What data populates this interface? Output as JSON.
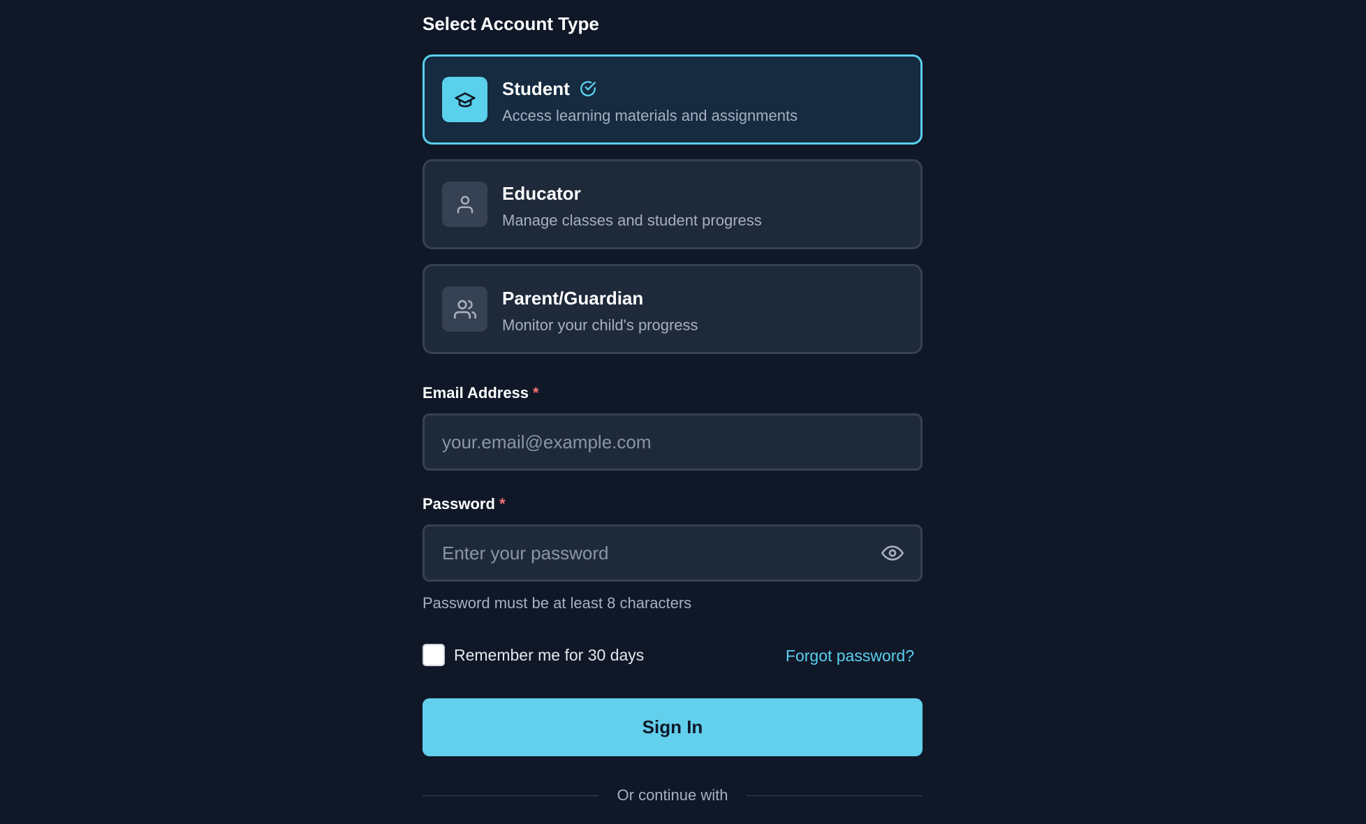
{
  "account_section": {
    "title": "Select Account Type",
    "options": [
      {
        "icon": "graduation-cap-icon",
        "title": "Student",
        "description": "Access learning materials and assignments",
        "selected": true
      },
      {
        "icon": "user-icon",
        "title": "Educator",
        "description": "Manage classes and student progress",
        "selected": false
      },
      {
        "icon": "users-icon",
        "title": "Parent/Guardian",
        "description": "Monitor your child's progress",
        "selected": false
      }
    ]
  },
  "email": {
    "label": "Email Address",
    "required_mark": "*",
    "value": "",
    "placeholder": "your.email@example.com"
  },
  "password": {
    "label": "Password",
    "required_mark": "*",
    "value": "",
    "placeholder": "Enter your password",
    "toggle_icon": "eye-icon",
    "hint": "Password must be at least 8 characters"
  },
  "remember": {
    "label": "Remember me for 30 days",
    "checked": false
  },
  "forgot_label": "Forgot password?",
  "sign_in_label": "Sign In",
  "divider_text": "Or continue with",
  "colors": {
    "background": "#101828",
    "card": "#1e2939",
    "border": "#364153",
    "accent": "#5ad0ec",
    "button": "#62cfec",
    "required": "#f87171",
    "muted_text": "#a5b0c0"
  }
}
